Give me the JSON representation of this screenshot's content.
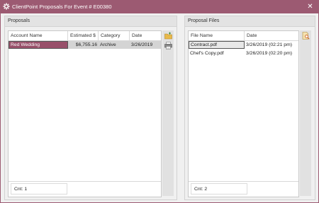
{
  "window": {
    "title": "ClientPoint Proposals For Event # E00380",
    "close_glyph": "✕"
  },
  "proposals": {
    "title": "Proposals",
    "columns": [
      "Account Name",
      "Estimated $",
      "Category",
      "Date"
    ],
    "rows": [
      {
        "account": "Red Wedding",
        "estimated": "$6,755.16",
        "category": "Archive",
        "date": "3/26/2019"
      }
    ],
    "count": "Cnt: 1",
    "tools": [
      "folder-add-icon",
      "printer-icon"
    ]
  },
  "files": {
    "title": "Proposal Files",
    "columns": [
      "File Name",
      "Date"
    ],
    "rows": [
      {
        "name": "Contract.pdf",
        "date": "3/26/2019 (02:21 pm)"
      },
      {
        "name": "Chef's Copy.pdf",
        "date": "3/26/2019 (02:20 pm)"
      }
    ],
    "count": "Cnt: 2",
    "tools": [
      "search-document-icon"
    ]
  },
  "colors": {
    "accent": "#9c5a72",
    "selection": "#98506a"
  }
}
